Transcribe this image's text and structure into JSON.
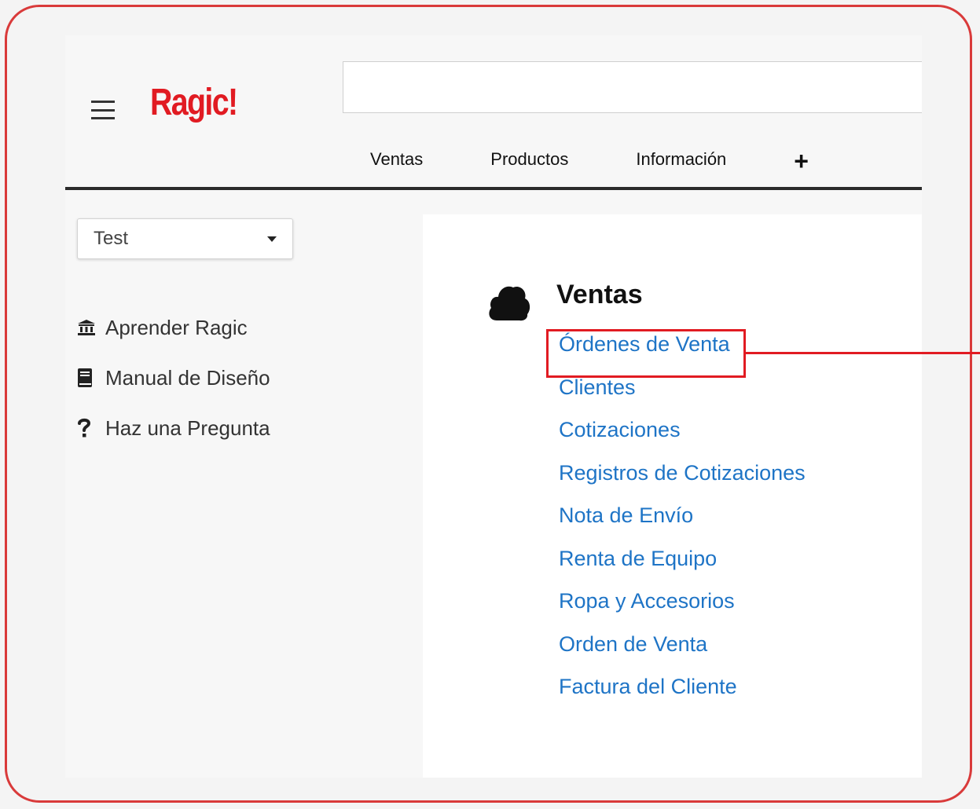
{
  "app": {
    "logo": "Ragic!",
    "search": {
      "value": "",
      "placeholder": ""
    }
  },
  "tabs": [
    {
      "label": "Ventas"
    },
    {
      "label": "Productos"
    },
    {
      "label": "Información"
    }
  ],
  "add_tab_label": "+",
  "sidebar": {
    "account_select": "Test",
    "links": [
      {
        "label": "Aprender Ragic",
        "icon": "bank-icon"
      },
      {
        "label": "Manual de Diseño",
        "icon": "book-icon"
      },
      {
        "label": "Haz una Pregunta",
        "icon": "question-icon"
      }
    ]
  },
  "section": {
    "icon": "cloud-icon",
    "title": "Ventas",
    "links": [
      "Órdenes de Venta",
      "Clientes",
      "Cotizaciones",
      "Registros de Cotizaciones",
      "Nota de Envío",
      "Renta de Equipo",
      "Ropa y Accesorios",
      "Orden de Venta",
      "Factura del Cliente"
    ]
  },
  "colors": {
    "brand": "#e11b22",
    "link": "#1e74c6",
    "frame": "#d93a3a",
    "annotation": "#e11b22"
  }
}
